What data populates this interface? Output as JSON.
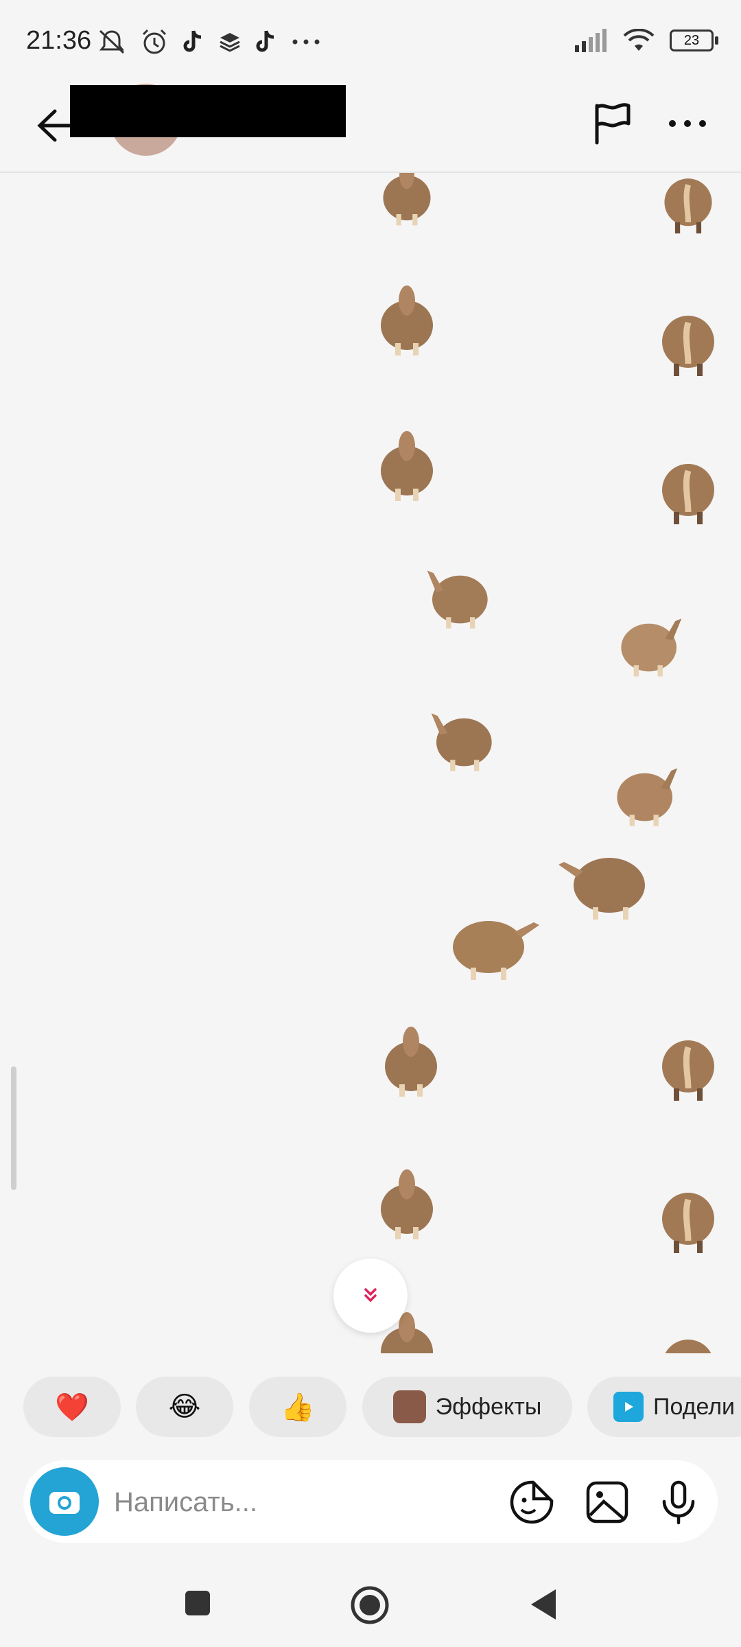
{
  "status_bar": {
    "time": "21:36",
    "battery": "23",
    "icons": [
      "mute-bell-icon",
      "alarm-icon",
      "tiktok-icon",
      "layers-icon",
      "tiktok-icon",
      "more-dots-icon",
      "signal-icon",
      "wifi-icon",
      "battery-icon"
    ]
  },
  "header": {
    "actions": [
      "back-arrow-icon",
      "flag-icon",
      "more-icon"
    ]
  },
  "chat": {
    "sticker_description_icon": "fat-horse-sticker",
    "scroll_down_icon": "double-chevron-down-icon"
  },
  "quick_reactions": {
    "heart": "❤️",
    "laugh": "😂",
    "thumbs_up": "👍",
    "effects_label": "Эффекты",
    "share_label": "Подели"
  },
  "composer": {
    "placeholder": "Написать...",
    "icons": [
      "camera-icon",
      "sticker-icon",
      "gallery-icon",
      "microphone-icon"
    ]
  },
  "navigation": {
    "icons": [
      "recent-apps-icon",
      "home-icon",
      "back-icon"
    ]
  },
  "colors": {
    "background": "#f6f5f6",
    "accent": "#23a4d4",
    "sticker": "#9c7552"
  }
}
